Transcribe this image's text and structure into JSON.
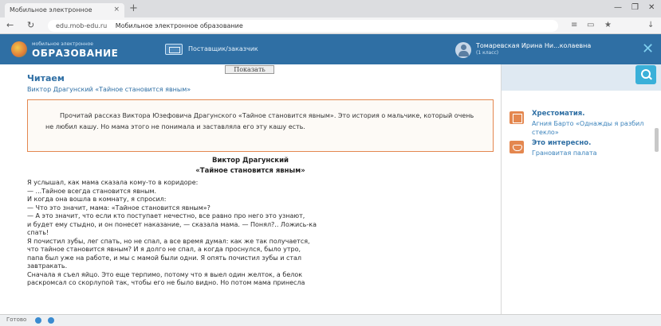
{
  "browser": {
    "tab_title": "Мобильное электронное",
    "tab_close": "×",
    "new_tab": "+",
    "url_host": "edu.mob-edu.ru",
    "url_page": "Мобильное электронное образование",
    "window_controls": [
      "—",
      "❐",
      "✕"
    ],
    "nav_back": "←",
    "nav_reload": "↻"
  },
  "header": {
    "logo_small": "мобильное электронное",
    "logo_big": "ОБРАЗОВАНИЕ",
    "nav_label": "Поставщик/заказчик",
    "user_name": "Томаревская Ирина Ни...колаевна",
    "user_grade": "(1 класс)",
    "close": "✕"
  },
  "main": {
    "show_button": "Показать",
    "section_title": "Читаем",
    "section_subtitle": "Виктор Драгунский «Тайное становится явным»",
    "note": "Прочитай рассказ Виктора Юзефовича Драгунского «Тайное становится явным». Это история о мальчике, который очень не любил кашу. Но мама этого не понимала и заставляла его эту кашу есть.",
    "story_author": "Виктор Драгунский",
    "story_title": "«Тайное становится явным»",
    "story_lines": [
      "Я услышал, как мама сказала кому-то в коридоре:",
      "— ...Тайное всегда становится явным.",
      "И когда она вошла в комнату, я спросил:",
      "— Что это значит, мама: «Тайное становится явным»?",
      "— А это значит, что если кто поступает нечестно, все равно про него это узнают,",
      "и будет ему стыдно, и он понесет наказание, — сказала мама. — Понял?.. Ложись-ка",
      "спать!",
      "Я почистил зубы, лег спать, но не спал, а все время думал: как же так получается,",
      "что тайное становится явным? И я долго не спал, а когда проснулся, было утро,",
      "папа был уже на работе, и мы с мамой были одни. Я опять почистил зубы и стал",
      "завтракать.",
      "Сначала я съел яйцо. Это еще терпимо, потому что я выел один желток, а белок",
      "раскромсал со скорлупой так, чтобы его не было видно. Но потом мама принесла"
    ]
  },
  "sidebar": {
    "items": [
      {
        "title": "Хрестоматия.",
        "text": "Агния Барто «Однажды я разбил стекло»",
        "icon": "book-icon"
      },
      {
        "title": "Это интересно.",
        "text": "Грановитая палата",
        "icon": "mask-icon"
      }
    ]
  },
  "status": {
    "text": "Готово"
  },
  "colors": {
    "brand_blue": "#2f6fa4",
    "accent_orange": "#e4874f",
    "accent_cyan": "#3ab0d9"
  }
}
